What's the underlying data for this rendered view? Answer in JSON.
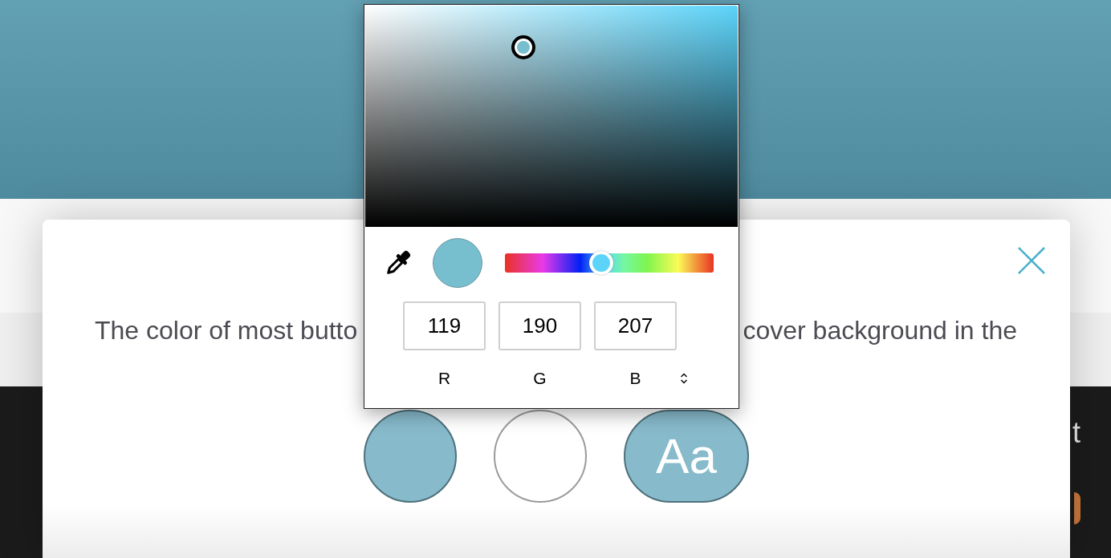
{
  "page": {
    "section_text": "t"
  },
  "modal": {
    "text_fragments": [
      "The color of most butto",
      "cover background in the"
    ],
    "swatches": [
      {
        "kind": "swatch",
        "color": "#87bacb"
      },
      {
        "kind": "swatch",
        "color": "#ffffff"
      },
      {
        "kind": "text-sample",
        "label": "Aa",
        "color": "#87bacb"
      }
    ]
  },
  "color_picker": {
    "hue_slider": {
      "level": 0.46
    },
    "channels": [
      {
        "value": "119",
        "label": "R"
      },
      {
        "value": "190",
        "label": "G"
      },
      {
        "value": "207",
        "label": "B"
      }
    ]
  }
}
